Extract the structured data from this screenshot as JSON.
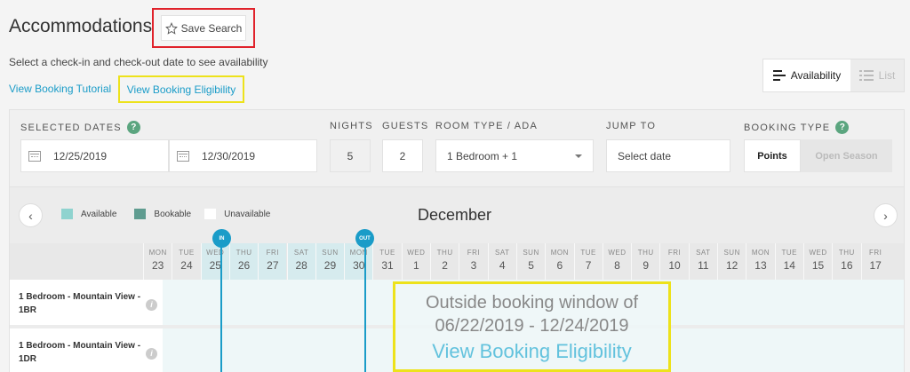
{
  "header": {
    "title": "Accommodations",
    "save_search_label": "Save Search",
    "subtitle": "Select a check-in and check-out date to see availability",
    "tutorial_link": "View Booking Tutorial",
    "eligibility_link": "View Booking Eligibility"
  },
  "view_toggle": {
    "availability": "Availability",
    "list": "List"
  },
  "filters": {
    "selected_dates_label": "SELECTED DATES",
    "check_in": "12/25/2019",
    "check_out": "12/30/2019",
    "nights_label": "NIGHTS",
    "nights": "5",
    "guests_label": "GUESTS",
    "guests": "2",
    "room_type_label": "ROOM TYPE / ADA",
    "room_type": "1 Bedroom + 1",
    "jump_to_label": "JUMP TO",
    "jump_to_placeholder": "Select date",
    "booking_type_label": "BOOKING TYPE",
    "booking_points": "Points",
    "booking_open_season": "Open Season",
    "help_glyph": "?"
  },
  "legend": {
    "available": "Available",
    "bookable": "Bookable",
    "unavailable": "Unavailable"
  },
  "colors": {
    "available": "#8fd3cf",
    "bookable": "#5f9c90",
    "unavailable": "#ffffff",
    "accent": "#1a9cc8"
  },
  "calendar": {
    "month": "December",
    "in_label": "IN",
    "out_label": "OUT",
    "days": [
      {
        "dow": "MON",
        "num": "23"
      },
      {
        "dow": "TUE",
        "num": "24"
      },
      {
        "dow": "WED",
        "num": "25"
      },
      {
        "dow": "THU",
        "num": "26"
      },
      {
        "dow": "FRI",
        "num": "27"
      },
      {
        "dow": "SAT",
        "num": "28"
      },
      {
        "dow": "SUN",
        "num": "29"
      },
      {
        "dow": "MON",
        "num": "30"
      },
      {
        "dow": "TUE",
        "num": "31"
      },
      {
        "dow": "WED",
        "num": "1"
      },
      {
        "dow": "THU",
        "num": "2"
      },
      {
        "dow": "FRI",
        "num": "3"
      },
      {
        "dow": "SAT",
        "num": "4"
      },
      {
        "dow": "SUN",
        "num": "5"
      },
      {
        "dow": "MON",
        "num": "6"
      },
      {
        "dow": "TUE",
        "num": "7"
      },
      {
        "dow": "WED",
        "num": "8"
      },
      {
        "dow": "THU",
        "num": "9"
      },
      {
        "dow": "FRI",
        "num": "10"
      },
      {
        "dow": "SAT",
        "num": "11"
      },
      {
        "dow": "SUN",
        "num": "12"
      },
      {
        "dow": "MON",
        "num": "13"
      },
      {
        "dow": "TUE",
        "num": "14"
      },
      {
        "dow": "WED",
        "num": "15"
      },
      {
        "dow": "THU",
        "num": "16"
      },
      {
        "dow": "FRI",
        "num": "17"
      }
    ],
    "rooms": [
      {
        "name": "1 Bedroom - Mountain View - 1BR"
      },
      {
        "name": "1 Bedroom - Mountain View - 1DR"
      }
    ]
  },
  "outside_window": {
    "line1": "Outside booking window of",
    "line2": "06/22/2019 - 12/24/2019",
    "link": "View Booking Eligibility"
  }
}
